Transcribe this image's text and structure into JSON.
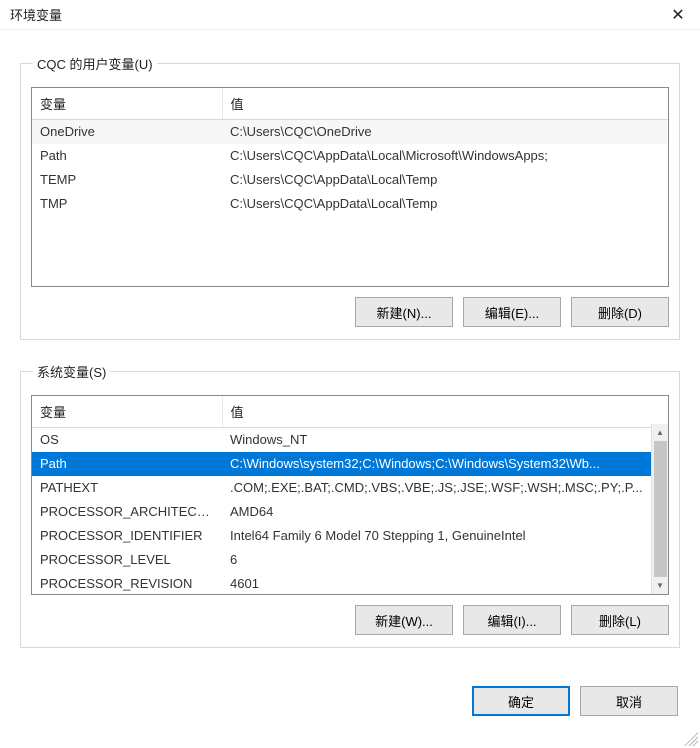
{
  "title": "环境变量",
  "user_group": {
    "legend": "CQC 的用户变量(U)",
    "headers": {
      "variable": "变量",
      "value": "值"
    },
    "rows": [
      {
        "var": "OneDrive",
        "val": "C:\\Users\\CQC\\OneDrive"
      },
      {
        "var": "Path",
        "val": "C:\\Users\\CQC\\AppData\\Local\\Microsoft\\WindowsApps;"
      },
      {
        "var": "TEMP",
        "val": "C:\\Users\\CQC\\AppData\\Local\\Temp"
      },
      {
        "var": "TMP",
        "val": "C:\\Users\\CQC\\AppData\\Local\\Temp"
      }
    ],
    "buttons": {
      "new": "新建(N)...",
      "edit": "编辑(E)...",
      "delete": "删除(D)"
    }
  },
  "system_group": {
    "legend": "系统变量(S)",
    "headers": {
      "variable": "变量",
      "value": "值"
    },
    "rows": [
      {
        "var": "OS",
        "val": "Windows_NT",
        "selected": false
      },
      {
        "var": "Path",
        "val": "C:\\Windows\\system32;C:\\Windows;C:\\Windows\\System32\\Wb...",
        "selected": true
      },
      {
        "var": "PATHEXT",
        "val": ".COM;.EXE;.BAT;.CMD;.VBS;.VBE;.JS;.JSE;.WSF;.WSH;.MSC;.PY;.P...",
        "selected": false
      },
      {
        "var": "PROCESSOR_ARCHITECT...",
        "val": "AMD64",
        "selected": false
      },
      {
        "var": "PROCESSOR_IDENTIFIER",
        "val": "Intel64 Family 6 Model 70 Stepping 1, GenuineIntel",
        "selected": false
      },
      {
        "var": "PROCESSOR_LEVEL",
        "val": "6",
        "selected": false
      },
      {
        "var": "PROCESSOR_REVISION",
        "val": "4601",
        "selected": false
      }
    ],
    "buttons": {
      "new": "新建(W)...",
      "edit": "编辑(I)...",
      "delete": "删除(L)"
    }
  },
  "dialog_buttons": {
    "ok": "确定",
    "cancel": "取消"
  }
}
